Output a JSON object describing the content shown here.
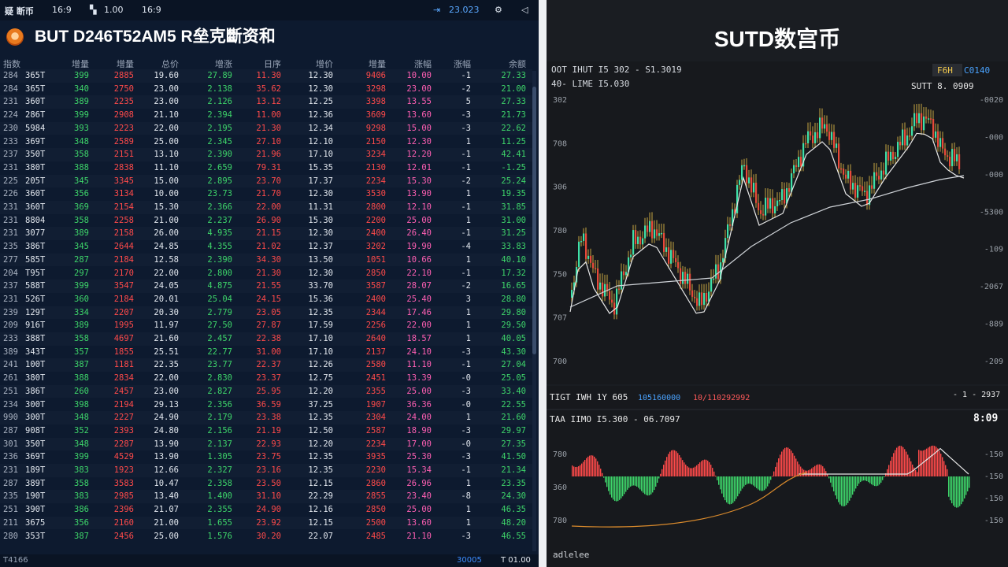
{
  "statusbar": {
    "app_name": "疑 断币",
    "ratio": "16:9",
    "signal_value": "1.00",
    "time": "16:9",
    "right_value": "23.023"
  },
  "left_panel": {
    "title": "BUT D246T52AM5  R垒克斷资和",
    "columns": [
      "指数",
      "增量",
      "增量",
      "总价",
      "增涨",
      "日序",
      "增价",
      "增量",
      "涨幅",
      "涨幅",
      "余额"
    ],
    "rows": [
      [
        "284",
        "365T",
        "399",
        "2885",
        "19.60",
        "27.89",
        "11.30",
        "12.30",
        "9406",
        "10.00",
        "-1",
        "27.33"
      ],
      [
        "284",
        "365T",
        "340",
        "2750",
        "23.00",
        "2.138",
        "35.62",
        "12.30",
        "3298",
        "23.00",
        "-2",
        "21.00"
      ],
      [
        "231",
        "360T",
        "389",
        "2235",
        "23.00",
        "2.126",
        "13.12",
        "12.25",
        "3398",
        "13.55",
        "5",
        "27.33"
      ],
      [
        "224",
        "286T",
        "399",
        "2908",
        "21.10",
        "2.394",
        "11.00",
        "12.36",
        "3609",
        "13.60",
        "-3",
        "21.73"
      ],
      [
        "230",
        "5984",
        "393",
        "2223",
        "22.00",
        "2.195",
        "21.30",
        "12.34",
        "9298",
        "15.00",
        "-3",
        "22.62"
      ],
      [
        "233",
        "369T",
        "348",
        "2589",
        "25.00",
        "2.345",
        "27.10",
        "12.10",
        "2150",
        "12.30",
        "1",
        "11.25"
      ],
      [
        "237",
        "350T",
        "358",
        "2151",
        "13.10",
        "2.390",
        "21.96",
        "17.10",
        "3234",
        "12.20",
        "-1",
        "42.41"
      ],
      [
        "231",
        "380T",
        "388",
        "2838",
        "11.10",
        "2.659",
        "79.31",
        "15.35",
        "2130",
        "12.01",
        "-1",
        "-1.25"
      ],
      [
        "225",
        "205T",
        "345",
        "3345",
        "15.00",
        "2.895",
        "23.70",
        "17.37",
        "2234",
        "15.30",
        "-2",
        "25.24"
      ],
      [
        "226",
        "360T",
        "356",
        "3134",
        "10.00",
        "23.73",
        "21.70",
        "12.30",
        "3530",
        "13.90",
        "1",
        "19.35"
      ],
      [
        "231",
        "360T",
        "369",
        "2154",
        "15.30",
        "2.366",
        "22.00",
        "11.31",
        "2800",
        "12.10",
        "-1",
        "31.85"
      ],
      [
        "231",
        "8804",
        "358",
        "2258",
        "21.00",
        "2.237",
        "26.90",
        "15.30",
        "2200",
        "25.00",
        "1",
        "31.00"
      ],
      [
        "231",
        "3077",
        "389",
        "2158",
        "26.00",
        "4.935",
        "21.15",
        "12.30",
        "2400",
        "26.40",
        "-1",
        "31.25"
      ],
      [
        "235",
        "386T",
        "345",
        "2644",
        "24.85",
        "4.355",
        "21.02",
        "12.37",
        "3202",
        "19.90",
        "-4",
        "33.83"
      ],
      [
        "277",
        "585T",
        "287",
        "2184",
        "12.58",
        "2.390",
        "34.30",
        "13.50",
        "1051",
        "10.66",
        "1",
        "40.10"
      ],
      [
        "204",
        "T95T",
        "297",
        "2170",
        "22.00",
        "2.800",
        "21.30",
        "12.30",
        "2850",
        "22.10",
        "-1",
        "17.32"
      ],
      [
        "237",
        "588T",
        "399",
        "3547",
        "24.05",
        "4.875",
        "21.55",
        "33.70",
        "3587",
        "28.07",
        "-2",
        "16.65"
      ],
      [
        "231",
        "526T",
        "360",
        "2184",
        "20.01",
        "25.04",
        "24.15",
        "15.36",
        "2400",
        "25.40",
        "3",
        "28.80"
      ],
      [
        "239",
        "129T",
        "334",
        "2207",
        "20.30",
        "2.779",
        "23.05",
        "12.35",
        "2344",
        "17.46",
        "1",
        "29.80"
      ],
      [
        "209",
        "916T",
        "389",
        "1995",
        "11.97",
        "27.50",
        "27.87",
        "17.59",
        "2256",
        "22.00",
        "1",
        "29.50"
      ],
      [
        "233",
        "388T",
        "358",
        "4697",
        "21.60",
        "2.457",
        "22.38",
        "17.10",
        "2640",
        "18.57",
        "1",
        "40.05"
      ],
      [
        "389",
        "343T",
        "357",
        "1855",
        "25.51",
        "22.77",
        "31.00",
        "17.10",
        "2137",
        "24.10",
        "-3",
        "43.30"
      ],
      [
        "241",
        "100T",
        "387",
        "1181",
        "22.35",
        "23.77",
        "22.37",
        "12.26",
        "2580",
        "11.10",
        "-1",
        "27.04"
      ],
      [
        "261",
        "380T",
        "388",
        "2834",
        "22.00",
        "2.830",
        "23.37",
        "12.75",
        "2451",
        "13.39",
        "-0",
        "25.05"
      ],
      [
        "251",
        "386T",
        "260",
        "2457",
        "23.00",
        "2.827",
        "25.95",
        "12.20",
        "2355",
        "25.00",
        "-3",
        "33.40"
      ],
      [
        "234",
        "300T",
        "398",
        "2194",
        "29.13",
        "2.356",
        "36.59",
        "37.25",
        "1907",
        "36.36",
        "-0",
        "22.55"
      ],
      [
        "990",
        "300T",
        "348",
        "2227",
        "24.90",
        "2.179",
        "23.38",
        "12.35",
        "2304",
        "24.00",
        "1",
        "21.60"
      ],
      [
        "287",
        "908T",
        "352",
        "2393",
        "24.80",
        "2.156",
        "21.19",
        "12.50",
        "2587",
        "18.90",
        "-3",
        "29.97"
      ],
      [
        "301",
        "350T",
        "348",
        "2287",
        "13.90",
        "2.137",
        "22.93",
        "12.20",
        "2234",
        "17.00",
        "-0",
        "27.35"
      ],
      [
        "236",
        "369T",
        "399",
        "4529",
        "13.90",
        "1.305",
        "23.75",
        "12.35",
        "3935",
        "25.30",
        "-3",
        "41.50"
      ],
      [
        "231",
        "189T",
        "383",
        "1923",
        "12.66",
        "2.327",
        "23.16",
        "12.35",
        "2230",
        "15.34",
        "-1",
        "21.34"
      ],
      [
        "287",
        "389T",
        "358",
        "3583",
        "10.47",
        "2.358",
        "23.50",
        "12.15",
        "2860",
        "26.96",
        "1",
        "23.35"
      ],
      [
        "235",
        "190T",
        "383",
        "2985",
        "13.40",
        "1.400",
        "31.10",
        "22.29",
        "2855",
        "23.40",
        "-8",
        "24.30"
      ],
      [
        "251",
        "390T",
        "386",
        "2396",
        "21.07",
        "2.355",
        "24.90",
        "12.16",
        "2850",
        "25.00",
        "1",
        "46.35"
      ],
      [
        "211",
        "3675",
        "356",
        "2160",
        "21.00",
        "1.655",
        "23.92",
        "12.15",
        "2500",
        "13.60",
        "1",
        "48.20"
      ],
      [
        "280",
        "353T",
        "387",
        "2456",
        "25.00",
        "1.576",
        "30.20",
        "22.07",
        "2485",
        "21.10",
        "-3",
        "46.55"
      ]
    ],
    "footer_left": "T4166",
    "footer_mid": "30005",
    "footer_right": "T 01.00"
  },
  "right_panel": {
    "title": "SUTD数宫币",
    "main_chart": {
      "info_line1": "OOT  IHUT I5 302 - S1.3019",
      "info_line2": "40-  LIME I5.030",
      "tag_left": "F6H",
      "tag_right": "C0140",
      "series_label": "SUTT 8. 0909",
      "y_left_ticks": [
        "302",
        "708",
        "306",
        "780",
        "750",
        "707",
        "700"
      ],
      "y_right_ticks": [
        "-0020",
        "-000",
        "-000",
        "-5300",
        "-109",
        "-2067",
        "-889",
        "-209"
      ]
    },
    "sub_chart": {
      "label_line1": "TIGT  IWH 1Y 605",
      "label_blue": "105160000",
      "label_red": "10/110292992",
      "right_note": "- 1 - 2937",
      "label_line2": "TAA  IIMO I5.300 - 06.7097",
      "value_right": "8:09",
      "y_left_ticks": [
        "780",
        "360",
        "780"
      ],
      "y_right_ticks": [
        "-150",
        "-150",
        "-150",
        "-150"
      ],
      "footer": "adlelee"
    }
  },
  "colors": {
    "up": "#3ed66a",
    "down": "#ff4a4a",
    "pink": "#ff5fb3",
    "candle_up": "#3fe0a8",
    "candle_down": "#e84a3a",
    "wick_yellow": "#f2c94c",
    "ma_line": "#e6e6e6",
    "orange_line": "#d98a2c"
  }
}
